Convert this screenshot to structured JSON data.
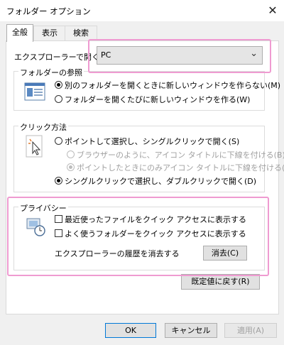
{
  "window": {
    "title": "フォルダー オプション"
  },
  "tabs": [
    {
      "label": "全般"
    },
    {
      "label": "表示"
    },
    {
      "label": "検索"
    }
  ],
  "general": {
    "open_in_label": "エクスプローラーで開く:",
    "open_in_value": "PC",
    "browse": {
      "title": "フォルダーの参照",
      "opt1": "別のフォルダーを開くときに新しいウィンドウを作らない(M)",
      "opt2": "フォルダーを開くたびに新しいウィンドウを作る(W)",
      "selected": 1
    },
    "click": {
      "title": "クリック方法",
      "opt1": "ポイントして選択し、シングルクリックで開く(S)",
      "sub1": "ブラウザーのように、アイコン タイトルに下線を付ける(B)",
      "sub2": "ポイントしたときにのみアイコン タイトルに下線を付ける(P)",
      "opt2": "シングルクリックで選択し、ダブルクリックで開く(D)",
      "selected": 2
    },
    "privacy": {
      "title": "プライバシー",
      "chk1": "最近使ったファイルをクイック アクセスに表示する",
      "chk2": "よく使うフォルダーをクイック アクセスに表示する",
      "clear_label": "エクスプローラーの履歴を消去する",
      "clear_button": "消去(C)"
    },
    "restore_button": "既定値に戻す(R)"
  },
  "footer": {
    "ok": "OK",
    "cancel": "キャンセル",
    "apply": "適用(A)"
  },
  "colors": {
    "highlight": "#ef9bd1",
    "accent": "#0078d7"
  }
}
